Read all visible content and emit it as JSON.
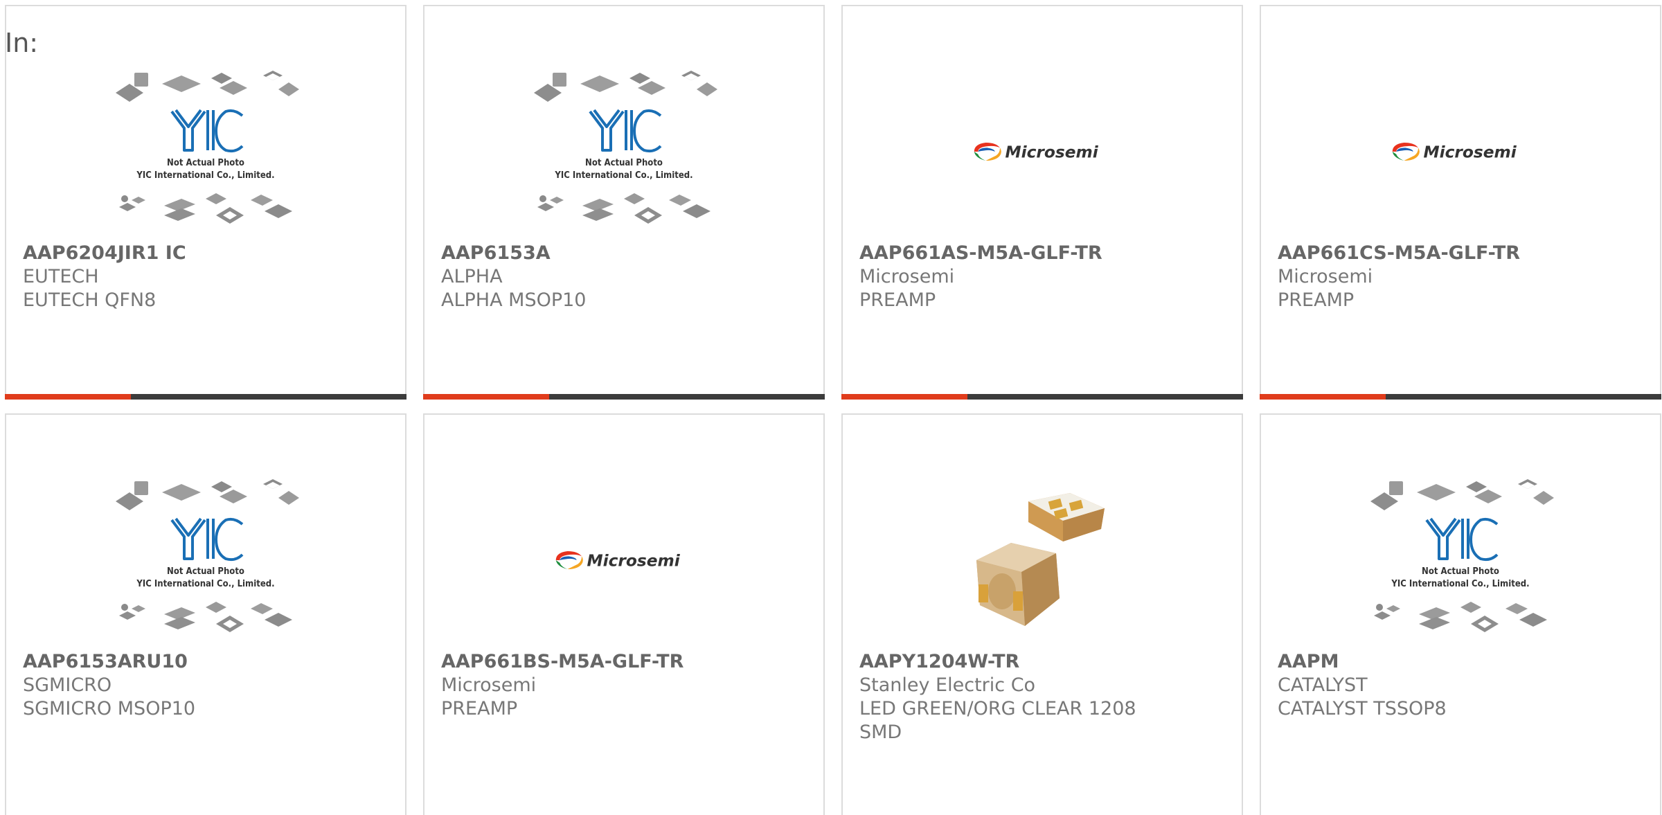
{
  "header": {
    "in_label": "In:"
  },
  "placeholder": {
    "line1": "Not Actual Photo",
    "line2": "YIC International Co., Limited."
  },
  "logo_text": "Microsemi",
  "products": [
    {
      "part": "AAP6204JIR1 IC",
      "mfr": "EUTECH",
      "desc": "EUTECH QFN8",
      "image": "placeholder"
    },
    {
      "part": "AAP6153A",
      "mfr": "ALPHA",
      "desc": "ALPHA MSOP10",
      "image": "placeholder"
    },
    {
      "part": "AAP661AS-M5A-GLF-TR",
      "mfr": "Microsemi",
      "desc": "PREAMP",
      "image": "microsemi-logo"
    },
    {
      "part": "AAP661CS-M5A-GLF-TR",
      "mfr": "Microsemi",
      "desc": "PREAMP",
      "image": "microsemi-logo"
    },
    {
      "part": "AAP6153ARU10",
      "mfr": "SGMICRO",
      "desc": "SGMICRO MSOP10",
      "image": "placeholder"
    },
    {
      "part": "AAP661BS-M5A-GLF-TR",
      "mfr": "Microsemi",
      "desc": "PREAMP",
      "image": "microsemi-logo"
    },
    {
      "part": "AAPY1204W-TR",
      "mfr": "Stanley Electric Co",
      "desc": "LED GREEN/ORG CLEAR 1208",
      "desc2": "SMD",
      "image": "led-photo"
    },
    {
      "part": "AAPM",
      "mfr": "CATALYST",
      "desc": "CATALYST TSSOP8",
      "image": "placeholder"
    }
  ],
  "colors": {
    "accent": "#e03c1c",
    "bar": "#3c3c3c",
    "border": "#dcdcdc",
    "yic_blue": "#1a6fb5"
  }
}
